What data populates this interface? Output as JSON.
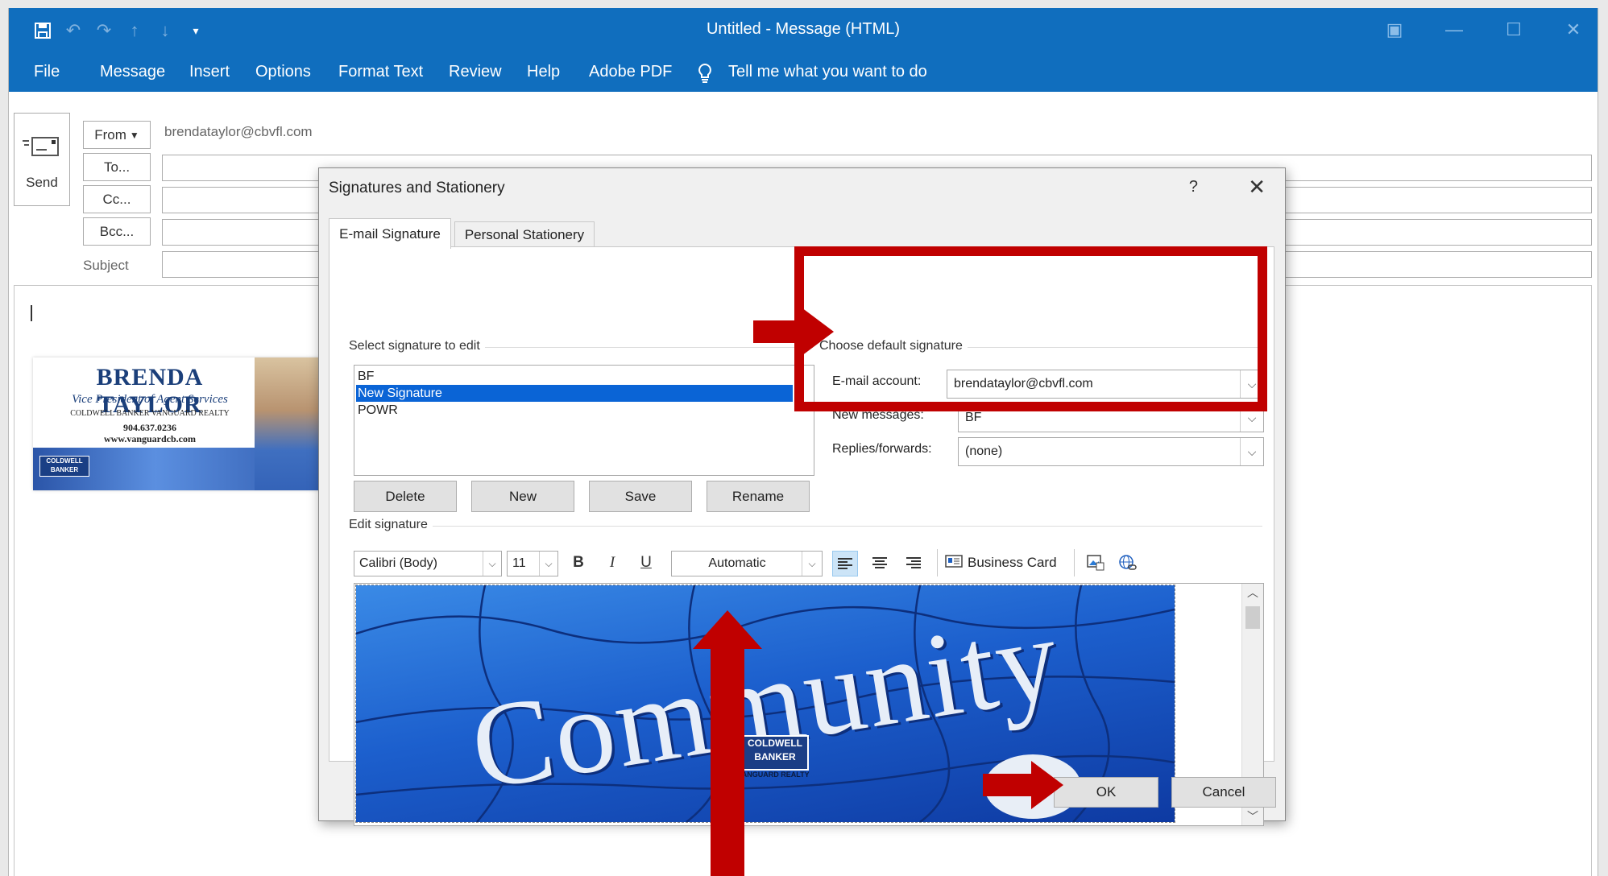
{
  "window": {
    "title": "Untitled  -  Message (HTML)"
  },
  "ribbon": {
    "tabs": [
      "File",
      "Message",
      "Insert",
      "Options",
      "Format Text",
      "Review",
      "Help",
      "Adobe PDF"
    ],
    "tell_me": "Tell me what you want to do"
  },
  "compose": {
    "send_label": "Send",
    "from_label": "From",
    "from_value": "brendataylor@cbvfl.com",
    "to_label": "To...",
    "cc_label": "Cc...",
    "bcc_label": "Bcc...",
    "subject_label": "Subject"
  },
  "email_signature": {
    "name": "BRENDA TAYLOR",
    "title": "Vice President of Agent Services",
    "company": "COLDWELL BANKER VANGUARD REALTY",
    "phone": "904.637.0236",
    "website": "www.vanguardcb.com",
    "logo": "COLDWELL BANKER"
  },
  "dialog": {
    "title": "Signatures and Stationery",
    "help": "?",
    "tabs": [
      "E-mail Signature",
      "Personal Stationery"
    ],
    "select_label": "Select signature to edit",
    "signatures": [
      "BF",
      "New Signature",
      "POWR"
    ],
    "selected_signature": "New Signature",
    "buttons": {
      "delete": "Delete",
      "new": "New",
      "save": "Save",
      "rename": "Rename",
      "ok": "OK",
      "cancel": "Cancel"
    },
    "default_group": {
      "label": "Choose default signature",
      "email_account_label": "E-mail account:",
      "email_account_value": "brendataylor@cbvfl.com",
      "new_messages_label": "New messages:",
      "new_messages_value": "BF",
      "replies_label": "Replies/forwards:",
      "replies_value": "(none)"
    },
    "edit_label": "Edit signature",
    "toolbar": {
      "font": "Calibri (Body)",
      "size": "11",
      "bold": "B",
      "italic": "I",
      "underline": "U",
      "color": "Automatic",
      "business_card": "Business Card"
    },
    "banner": {
      "text": "Community",
      "logo": "COLDWELL BANKER",
      "logo_sub": "VANGUARD REALTY"
    }
  },
  "colors": {
    "title_bar": "#106ebe",
    "selection": "#0a64d6",
    "annotation_red": "#c00000"
  }
}
